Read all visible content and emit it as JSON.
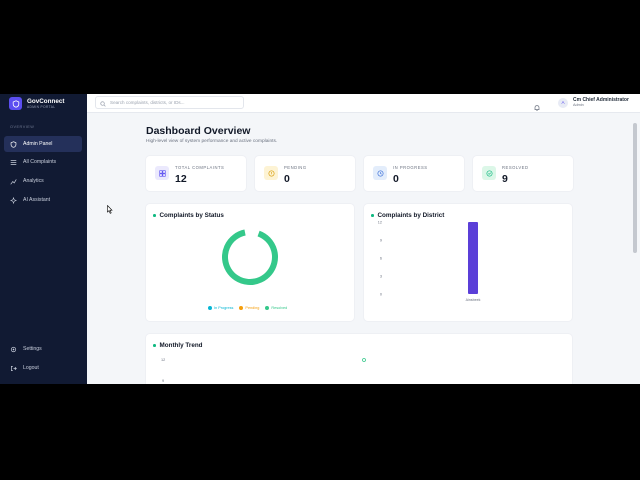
{
  "app": {
    "name": "GovConnect",
    "subtitle": "ADMIN PORTAL",
    "brand_color": "#5b4ef0"
  },
  "sidebar": {
    "section_label": "OVERVIEW",
    "items": [
      {
        "label": "Admin Panel",
        "icon": "shield-icon",
        "active": true
      },
      {
        "label": "All Complaints",
        "icon": "list-icon",
        "active": false
      },
      {
        "label": "Analytics",
        "icon": "chart-icon",
        "active": false
      },
      {
        "label": "AI Assistant",
        "icon": "sparkle-icon",
        "active": false
      }
    ],
    "bottom_items": [
      {
        "label": "Settings",
        "icon": "gear-icon"
      },
      {
        "label": "Logout",
        "icon": "logout-icon"
      }
    ]
  },
  "topbar": {
    "search_placeholder": "Search complaints, districts, or IDs...",
    "user_name": "Cm Chief Administrator",
    "user_role": "Admin",
    "avatar_initial": "A"
  },
  "page": {
    "title": "Dashboard Overview",
    "subtitle": "High-level view of system performance and active complaints."
  },
  "stats": [
    {
      "label": "TOTAL COMPLAINTS",
      "value": "12",
      "icon": "grid-icon",
      "bg": "#ebe9fd",
      "fg": "#5b4ef0"
    },
    {
      "label": "PENDING",
      "value": "0",
      "icon": "alert-circle-icon",
      "bg": "#fdf3d4",
      "fg": "#d79b05"
    },
    {
      "label": "IN PROGRESS",
      "value": "0",
      "icon": "clock-icon",
      "bg": "#e3edfb",
      "fg": "#3b6fd8"
    },
    {
      "label": "RESOLVED",
      "value": "9",
      "icon": "check-circle-icon",
      "bg": "#dcf7e8",
      "fg": "#10b981"
    }
  ],
  "panels": {
    "status_title": "Complaints by Status",
    "district_title": "Complaints by District",
    "trend_title": "Monthly Trend"
  },
  "chart_data": [
    {
      "type": "pie",
      "title": "Complaints by Status",
      "categories": [
        "In Progress",
        "Pending",
        "Resolved"
      ],
      "values": [
        0,
        0,
        9
      ],
      "colors": [
        "#06b6d4",
        "#f59e0b",
        "#34c88a"
      ],
      "legend": "bottom"
    },
    {
      "type": "bar",
      "title": "Complaints by District",
      "categories": [
        "Ainsbeek"
      ],
      "values": [
        12
      ],
      "ylim": [
        0,
        12
      ],
      "yticks": [
        0,
        3,
        6,
        9,
        12
      ],
      "colors": [
        "#5b3fd8"
      ]
    },
    {
      "type": "line",
      "title": "Monthly Trend",
      "yticks_visible": [
        "12",
        "9"
      ],
      "point_visible": [
        12
      ],
      "colors": [
        "#34c88a"
      ]
    }
  ]
}
